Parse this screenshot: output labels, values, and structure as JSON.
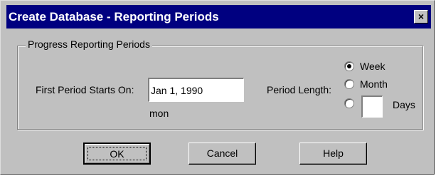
{
  "window": {
    "title": "Create Database - Reporting Periods",
    "close_glyph": "×",
    "close_icon": "close-icon"
  },
  "group": {
    "legend": "Progress Reporting Periods"
  },
  "first_period": {
    "label": "First Period Starts On:",
    "value": "Jan 1, 1990",
    "weekday": "mon"
  },
  "period_length": {
    "label": "Period Length:",
    "options": [
      {
        "label": "Week",
        "checked": true
      },
      {
        "label": "Month",
        "checked": false
      },
      {
        "label": "Days",
        "checked": false
      }
    ],
    "days_value": ""
  },
  "buttons": {
    "ok": "OK",
    "cancel": "Cancel",
    "help": "Help"
  },
  "colors": {
    "titlebar": "#000080",
    "dialog_face": "#c0c0c0"
  }
}
